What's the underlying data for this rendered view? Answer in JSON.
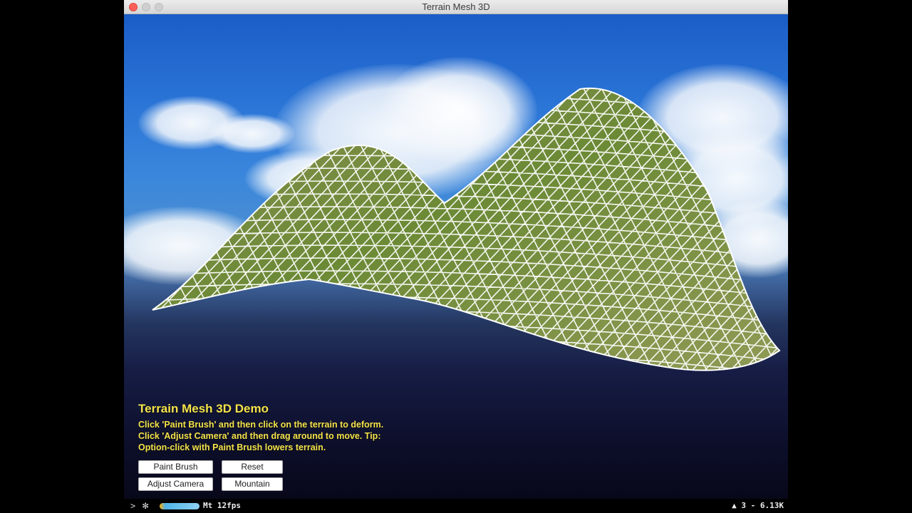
{
  "window": {
    "title": "Terrain Mesh 3D"
  },
  "overlay": {
    "title": "Terrain Mesh 3D Demo",
    "instructions": "Click 'Paint Brush' and then click on the terrain to deform. Click 'Adjust Camera' and then drag around to move. Tip: Option-click with Paint Brush lowers terrain."
  },
  "buttons": {
    "paint_brush": "Paint Brush",
    "reset": "Reset",
    "adjust_camera": "Adjust Camera",
    "mountain": "Mountain"
  },
  "status": {
    "arrow": ">",
    "gear": "✻",
    "fps_text": "Mt 12fps",
    "right_text": "▲ 3  - 6.13K"
  },
  "colors": {
    "overlay_text": "#f4e34a",
    "mesh_lines": "#ffffff",
    "terrain_fill": "#6f8a3a"
  }
}
